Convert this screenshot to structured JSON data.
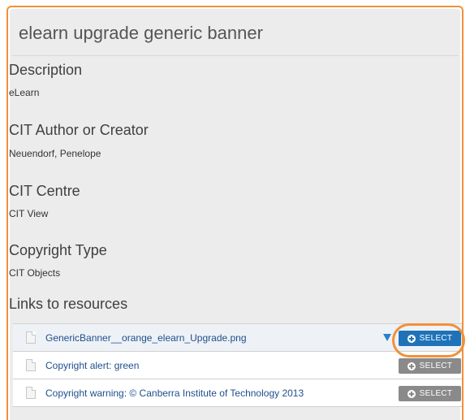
{
  "title": "elearn upgrade generic banner",
  "fields": [
    {
      "label": "Description",
      "value": "eLearn"
    },
    {
      "label": "CIT Author or Creator",
      "value": "Neuendorf, Penelope"
    },
    {
      "label": "CIT Centre",
      "value": "CIT View"
    },
    {
      "label": "Copyright Type",
      "value": "CIT Objects"
    }
  ],
  "links_label": "Links to resources",
  "resources": [
    {
      "name": "GenericBanner__orange_elearn_Upgrade.png",
      "icon": "document-icon",
      "has_expand": true,
      "select_label": "SELECT",
      "highlighted": true
    },
    {
      "name": "Copyright alert: green",
      "icon": "document-icon",
      "has_expand": false,
      "select_label": "SELECT",
      "highlighted": false
    },
    {
      "name": "Copyright warning: © Canberra Institute of Technology 2013",
      "icon": "document-icon",
      "has_expand": false,
      "select_label": "SELECT",
      "highlighted": false
    }
  ],
  "colors": {
    "accent_orange": "#f0913a",
    "select_active": "#1e73b8",
    "select_inactive": "#8a8a8a",
    "link_text": "#1f4e8c",
    "panel_bg": "#ececec"
  }
}
